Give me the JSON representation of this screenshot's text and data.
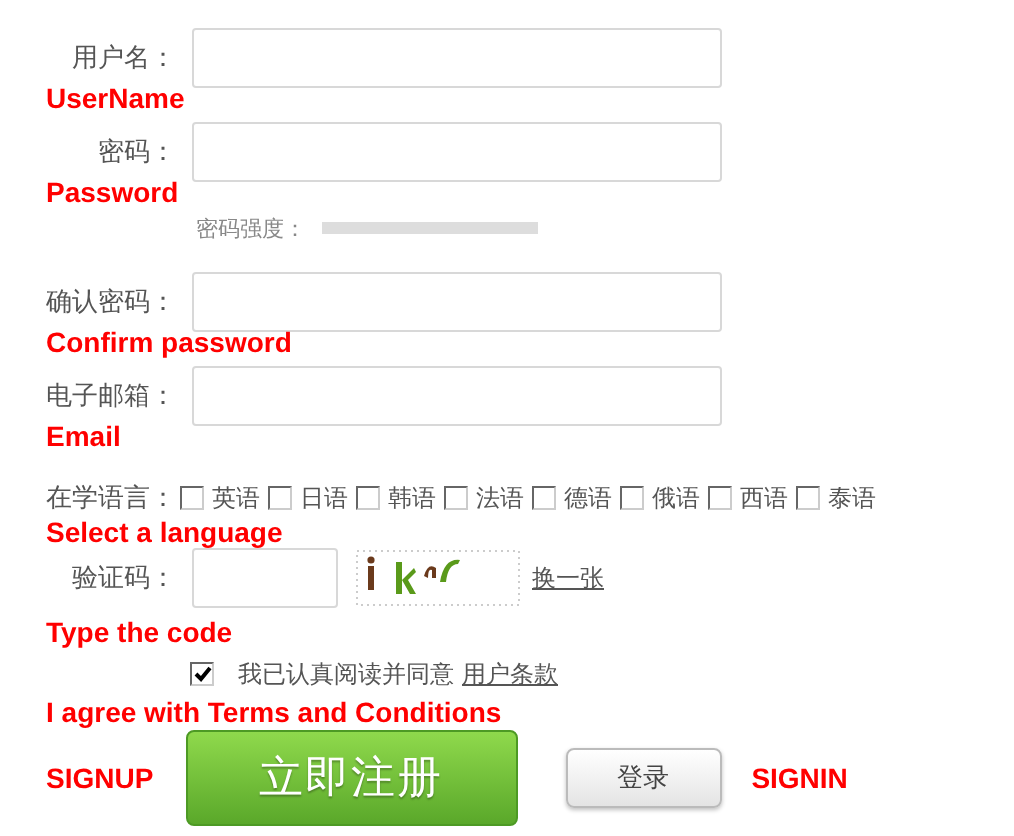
{
  "fields": [
    {
      "label": "用户名：",
      "annotation": "UserName"
    },
    {
      "label": "密码：",
      "annotation": "Password"
    },
    {
      "label": "确认密码：",
      "annotation": "Confirm password"
    },
    {
      "label": "电子邮箱：",
      "annotation": "Email"
    }
  ],
  "password_strength": {
    "label": "密码强度：",
    "level": 0
  },
  "languages": {
    "label": "在学语言：",
    "annotation": "Select a language",
    "options": [
      {
        "label": "英语",
        "checked": false
      },
      {
        "label": "日语",
        "checked": false
      },
      {
        "label": "韩语",
        "checked": false
      },
      {
        "label": "法语",
        "checked": false
      },
      {
        "label": "德语",
        "checked": false
      },
      {
        "label": "俄语",
        "checked": false
      },
      {
        "label": "西语",
        "checked": false
      },
      {
        "label": "泰语",
        "checked": false
      }
    ]
  },
  "captcha": {
    "label": "验证码：",
    "refresh_link": "换一张",
    "annotation": "Type the code"
  },
  "agreement": {
    "checked": true,
    "text": "我已认真阅读并同意",
    "link": "用户条款",
    "annotation": "I agree with Terms and Conditions"
  },
  "actions": {
    "signup_note": "SIGNUP",
    "signup_button": "立即注册",
    "login_button": "登录",
    "signin_note": "SIGNIN"
  }
}
